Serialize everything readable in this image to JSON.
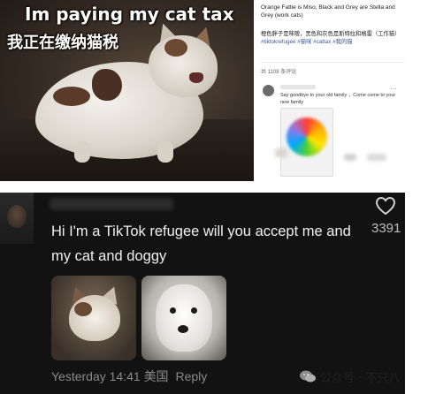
{
  "meme": {
    "caption_en": "Im paying my cat tax",
    "caption_zh": "我正在缴纳猫税"
  },
  "post": {
    "description_en": "Orange Fattie is Miso, Black and Grey are Stella and Grey (work cats)",
    "description_zh_main": "橙色胖子是味噌，黑色和灰色是斯特拉和格雷（工作猫）",
    "tags": "#tiktokrefugee #猫咪 #cattax #我的猫",
    "meta": "共 1108 条评论",
    "comment": "Say goodbye to your old family ，Come come to your new family"
  },
  "tiktok": {
    "comment": "Hi I'm a TikTok refugee will you accept me and my cat and doggy",
    "likes": "3391",
    "timestamp": "Yesterday 14:41 美国",
    "reply_label": "Reply"
  },
  "watermark": {
    "text": "公众号 · 不只八"
  },
  "colors": {
    "tiktok_bg": "#121212",
    "tag_blue": "#3b5998"
  }
}
